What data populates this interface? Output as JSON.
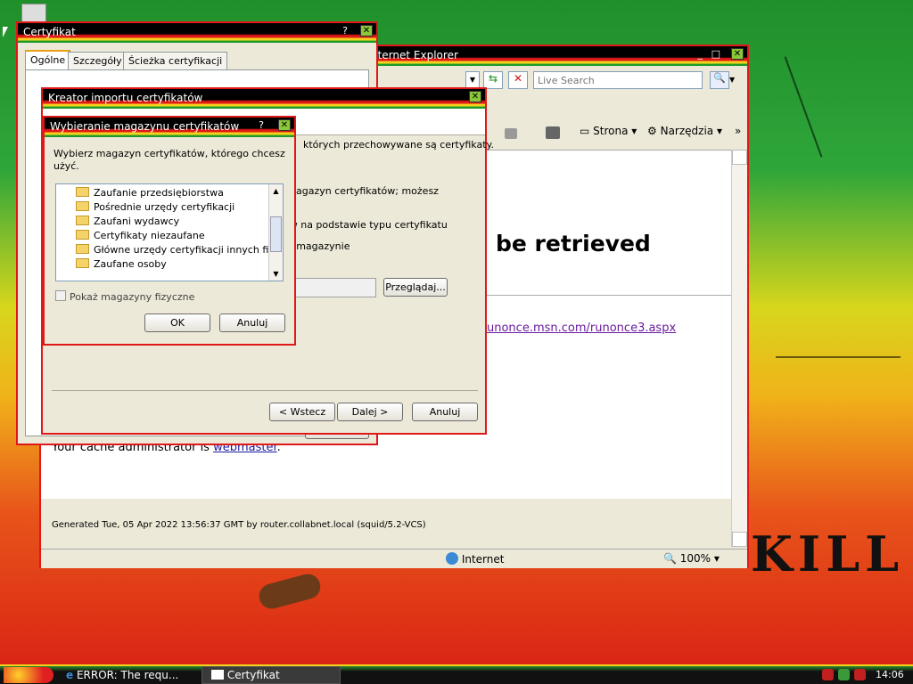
{
  "desktop": {
    "bg_word": "KILL"
  },
  "ie": {
    "title": "nternet Explorer",
    "search_placeholder": "Live Search",
    "toolbar_page": "Strona",
    "toolbar_tools": "Narzędzia",
    "heading": "be retrieved",
    "link": "unonce.msn.com/runonce3.aspx",
    "cache_admin": "Your cache administrator is",
    "webmaster": "webmaster",
    "footer": "Generated Tue, 05 Apr 2022 13:56:37 GMT by router.collabnet.local (squid/5.2-VCS)",
    "status_zone": "Internet",
    "zoom": "100%"
  },
  "cert": {
    "title": "Certyfikat",
    "tabs": [
      "Ogólne",
      "Szczegóły",
      "Ścieżka certyfikacji"
    ]
  },
  "wizard": {
    "title": "Kreator importu certyfikatów",
    "text1": "których przechowywane są certyfikaty.",
    "text2": "agazyn certyfikatów; możesz",
    "text3": "ow na podstawie typu certyfikatu",
    "text4": "m magazynie",
    "browse": "Przeglądaj...",
    "back": "< Wstecz",
    "next": "Dalej >",
    "cancel": "Anuluj"
  },
  "store": {
    "title": "Wybieranie magazynu certyfikatów",
    "help": "?",
    "prompt": "Wybierz magazyn certyfikatów, którego chcesz użyć.",
    "items": [
      "Zaufanie przedsiębiorstwa",
      "Pośrednie urzędy certyfikacji",
      "Zaufani wydawcy",
      "Certyfikaty niezaufane",
      "Główne urzędy certyfikacji innych firm",
      "Zaufane osoby"
    ],
    "show_physical": "Pokaż magazyny fizyczne",
    "ok": "OK",
    "cancel": "Anuluj"
  },
  "taskbar": {
    "task_ie": "ERROR: The requ...",
    "task_cert": "Certyfikat",
    "clock": "14:06"
  },
  "colors": {
    "title_red": "#e01818",
    "title_yellow": "#f3d21b",
    "title_green": "#1e9a2a",
    "link": "#6a1aa0"
  }
}
